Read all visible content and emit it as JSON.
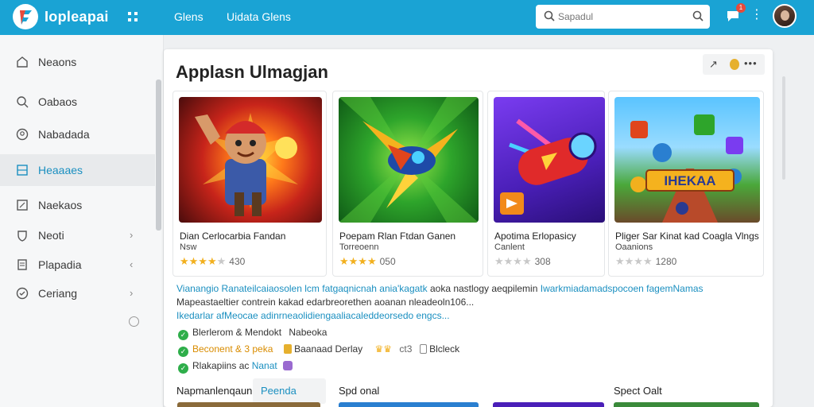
{
  "header": {
    "brand": "Iopleapai",
    "nav": [
      "Glens",
      "Uidata Glens"
    ],
    "search_placeholder": "Sapadul",
    "notification_count": "1"
  },
  "sidebar": {
    "items": [
      {
        "label": "Neaons",
        "icon": "home-icon"
      },
      {
        "label": "Oabaos",
        "icon": "search-icon"
      },
      {
        "label": "Nabadada",
        "icon": "person-icon"
      },
      {
        "label": "Heaaaes",
        "icon": "grid-icon",
        "active": true
      },
      {
        "label": "Naekaos",
        "icon": "edit-icon"
      },
      {
        "label": "Neoti",
        "icon": "shield-icon",
        "chevron": "›"
      },
      {
        "label": "Plapadia",
        "icon": "document-icon",
        "chevron": "‹"
      },
      {
        "label": "Ceriang",
        "icon": "check-circle-icon",
        "chevron": "›"
      }
    ]
  },
  "main": {
    "title": "Applasn Ulmagjan",
    "tools": {
      "arrow": "↗",
      "more": "•••"
    },
    "cards": [
      {
        "title": "Dian Cerlocarbia Fandan",
        "subtitle": "Nsw",
        "rating": 4,
        "count": "430",
        "accent": "#e0451c"
      },
      {
        "title": "Poepam Rlan Ftdan Ganen",
        "subtitle": "Torreoenn",
        "rating": 4,
        "count": "050",
        "accent": "#2ea52b"
      },
      {
        "title": "Apotima Erlopasicy",
        "subtitle": "Canlent",
        "rating": 0,
        "count": "308",
        "accent": "#5a2bc9"
      },
      {
        "title": "Pliger Sar Kinat kad Coagla Vlngs",
        "subtitle": "Oaanions",
        "rating": 0,
        "count": "1280",
        "accent": "#2a7fd0"
      }
    ],
    "thumb_text": "IHEKAA",
    "description": {
      "line1": "Vianangio Ranateilcaiaosolen lcm fatgaqnicnah ania'kagatk",
      "line1_dark": "aoka nastlogy aeqpilemin",
      "line1_tail": "Iwarkmiadamadspocoen fagemNamas",
      "line2": "Mapeastaeltier contrein kakad edarbreorethen aoanan nleadeoln106...",
      "line3": "Ikedarlar afMeocae adinrneaolidiengaaliacaleddeorsedo engcs..."
    },
    "features": [
      {
        "text": "Blerlerom & Mendokt",
        "extra": "Nabeoka"
      },
      {
        "text": "Beconent & 3 peka",
        "extra": "Baanaad Derlay",
        "extra2": "ct3",
        "extra3": "Blcleck"
      },
      {
        "text": "Rlakapiins ac",
        "extra": "Nanat"
      }
    ],
    "bottom_row": [
      "Napmanlenqauni",
      "Peenda",
      "Spd onal",
      "Spect Oalt"
    ],
    "colors": {
      "accent": "#1aa3d4",
      "link": "#1a8fc0",
      "star": "#f2b01e",
      "check": "#2eae4a"
    }
  }
}
